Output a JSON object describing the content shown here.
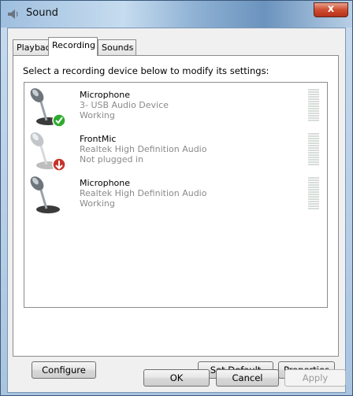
{
  "window": {
    "title": "Sound",
    "close_label": "x"
  },
  "tabs": [
    {
      "label": "Playback",
      "active": false
    },
    {
      "label": "Recording",
      "active": true
    },
    {
      "label": "Sounds",
      "active": false
    }
  ],
  "instruction": "Select a recording device below to modify its settings:",
  "devices": [
    {
      "name": "Microphone",
      "description": "3- USB Audio Device",
      "status": "Working",
      "badge": "check-icon",
      "badge_color": "#2eaa2e"
    },
    {
      "name": "FrontMic",
      "description": "Realtek High Definition Audio",
      "status": "Not plugged in",
      "badge": "down-arrow-icon",
      "badge_color": "#c8332b"
    },
    {
      "name": "Microphone",
      "description": "Realtek High Definition Audio",
      "status": "Working",
      "badge": "",
      "badge_color": ""
    }
  ],
  "buttons": {
    "configure": "Configure",
    "set_default": "Set Default",
    "properties": "Properties",
    "ok": "OK",
    "cancel": "Cancel",
    "apply": "Apply"
  }
}
